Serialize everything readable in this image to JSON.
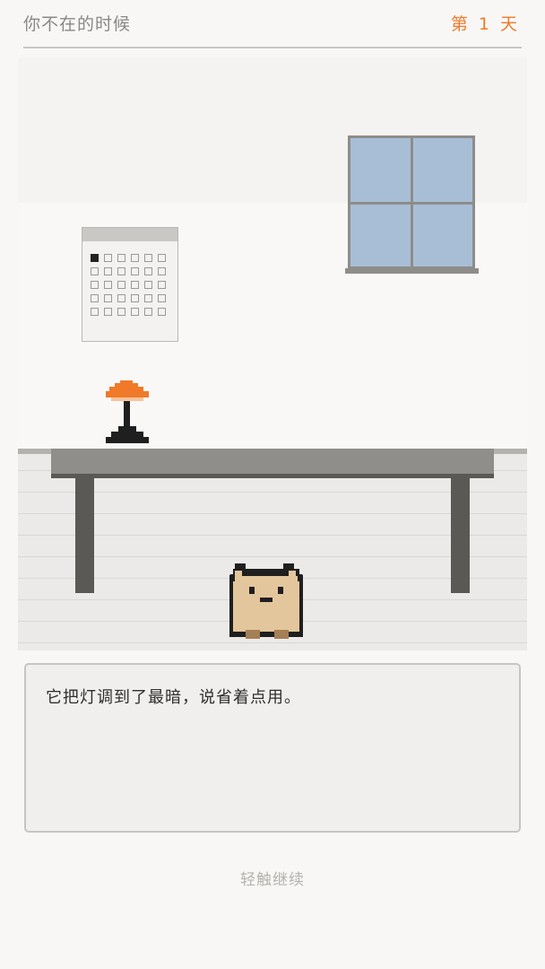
{
  "header": {
    "title": "你不在的时候",
    "day_label": "第 1 天"
  },
  "scene": {
    "calendar": {
      "columns": 6,
      "rows": 5,
      "marked_days": 1
    },
    "colors": {
      "lamp_shade": "#f07a2a",
      "window_glass": "#a8bed6",
      "cat_fur": "#e3c69c"
    }
  },
  "dialog": {
    "text": "它把灯调到了最暗，说省着点用。"
  },
  "hint": "轻触继续"
}
